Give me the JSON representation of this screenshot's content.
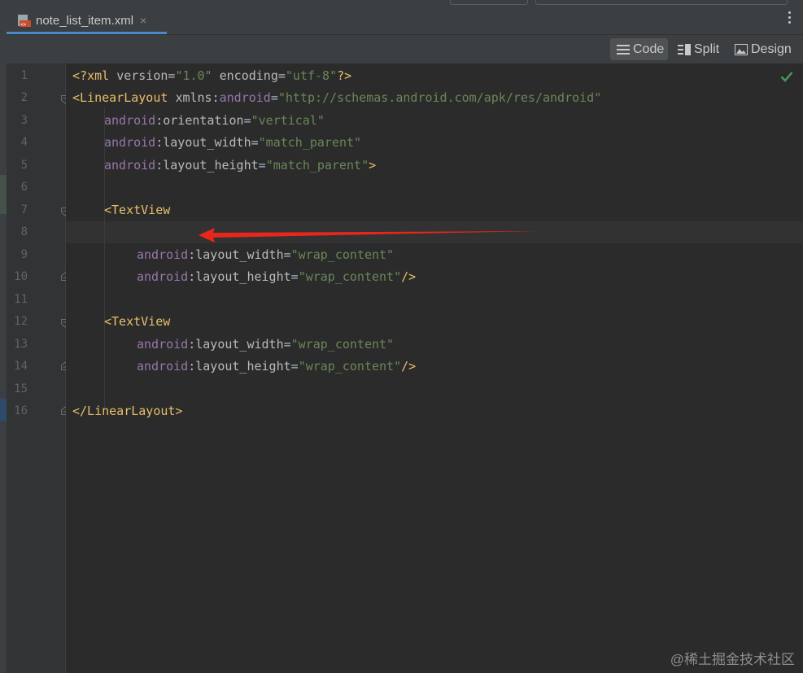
{
  "tab": {
    "title": "note_list_item.xml",
    "close_glyph": "×"
  },
  "view_modes": {
    "code": "Code",
    "split": "Split",
    "design": "Design"
  },
  "line_numbers": [
    "1",
    "2",
    "3",
    "4",
    "5",
    "6",
    "7",
    "8",
    "9",
    "10",
    "11",
    "12",
    "13",
    "14",
    "15",
    "16"
  ],
  "code": {
    "l1": {
      "a": "<?",
      "b": "xml ",
      "c": "version",
      "d": "=",
      "e": "\"1.0\"",
      "f": " ",
      "g": "encoding",
      "h": "=",
      "i": "\"utf-8\"",
      "j": "?>"
    },
    "l2": {
      "a": "<LinearLayout ",
      "b": "xmlns",
      "c": ":",
      "d": "android",
      "e": "=",
      "f": "\"http://schemas.android.com/apk/res/android\""
    },
    "l3": {
      "ns": "android",
      "attr": ":orientation",
      "eq": "=",
      "val": "\"vertical\""
    },
    "l4": {
      "ns": "android",
      "attr": ":layout_width",
      "eq": "=",
      "val": "\"match_parent\""
    },
    "l5": {
      "ns": "android",
      "attr": ":layout_height",
      "eq": "=",
      "val": "\"match_parent\"",
      "end": ">"
    },
    "l7": {
      "tag": "<TextView"
    },
    "l9": {
      "ns": "android",
      "attr": ":layout_width",
      "eq": "=",
      "val": "\"wrap_content\""
    },
    "l10": {
      "ns": "android",
      "attr": ":layout_height",
      "eq": "=",
      "val": "\"wrap_content\"",
      "end": "/>"
    },
    "l12": {
      "tag": "<TextView"
    },
    "l13": {
      "ns": "android",
      "attr": ":layout_width",
      "eq": "=",
      "val": "\"wrap_content\""
    },
    "l14": {
      "ns": "android",
      "attr": ":layout_height",
      "eq": "=",
      "val": "\"wrap_content\"",
      "end": "/>"
    },
    "l16": {
      "tag": "</LinearLayout>"
    }
  },
  "status_icon": "check-icon",
  "watermark": "@稀土掘金技术社区",
  "colors": {
    "tag": "#e8bf6a",
    "namespace": "#9876aa",
    "attribute": "#bababa",
    "value": "#6a8759",
    "line_number": "#606366",
    "annotation_arrow": "#e8261c",
    "check": "#499c54"
  }
}
